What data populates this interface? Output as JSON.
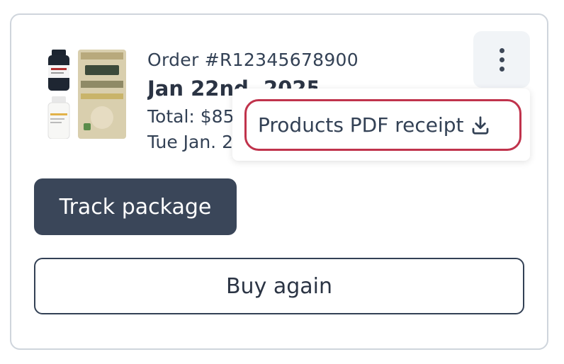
{
  "order": {
    "number": "Order #R12345678900",
    "date": "Jan 22nd, 2025",
    "total": "Total: $85",
    "ship_date": "Tue Jan. 2"
  },
  "menu": {
    "items": [
      {
        "label": "Products PDF receipt",
        "icon": "download-icon"
      }
    ]
  },
  "actions": {
    "track_label": "Track package",
    "buy_again_label": "Buy again"
  },
  "colors": {
    "primary_button": "#3a4659",
    "highlight_border": "#c0334c",
    "card_border": "#cfd5dc"
  }
}
